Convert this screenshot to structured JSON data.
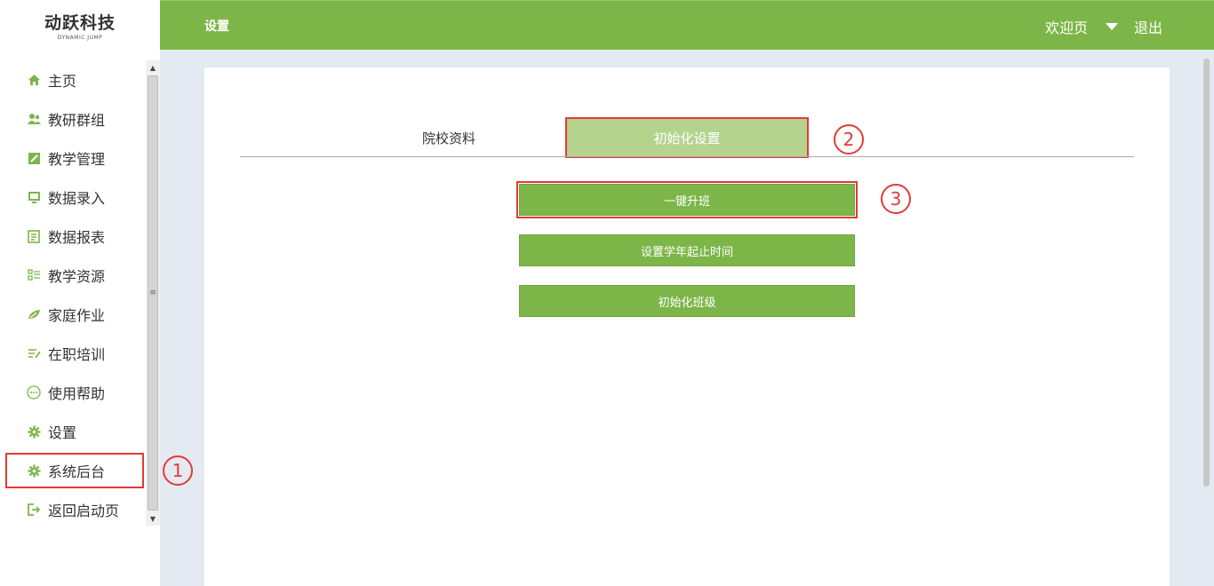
{
  "logo": {
    "main": "动跃科技",
    "sub": "DYNAMIC JUMP"
  },
  "header": {
    "title": "设置",
    "welcome": "欢迎页",
    "logout": "退出"
  },
  "sidebar": {
    "items": [
      {
        "label": "主页",
        "icon": "home-icon"
      },
      {
        "label": "教研群组",
        "icon": "users-icon"
      },
      {
        "label": "教学管理",
        "icon": "edit-icon"
      },
      {
        "label": "数据录入",
        "icon": "monitor-icon"
      },
      {
        "label": "数据报表",
        "icon": "report-icon"
      },
      {
        "label": "教学资源",
        "icon": "resource-icon"
      },
      {
        "label": "家庭作业",
        "icon": "homework-icon"
      },
      {
        "label": "在职培训",
        "icon": "training-icon"
      },
      {
        "label": "使用帮助",
        "icon": "help-icon"
      },
      {
        "label": "设置",
        "icon": "gear-icon"
      },
      {
        "label": "系统后台",
        "icon": "gear-icon"
      },
      {
        "label": "返回启动页",
        "icon": "exit-icon"
      }
    ]
  },
  "tabs": {
    "school_info": "院校资料",
    "init_settings": "初始化设置"
  },
  "actions": {
    "upgrade": "一键升班",
    "school_year": "设置学年起止时间",
    "init_class": "初始化班级"
  },
  "markers": {
    "one": "1",
    "two": "2",
    "three": "3"
  },
  "colors": {
    "accent": "#7db648",
    "tab_active": "#b4d48e",
    "annotation": "#e53935"
  }
}
